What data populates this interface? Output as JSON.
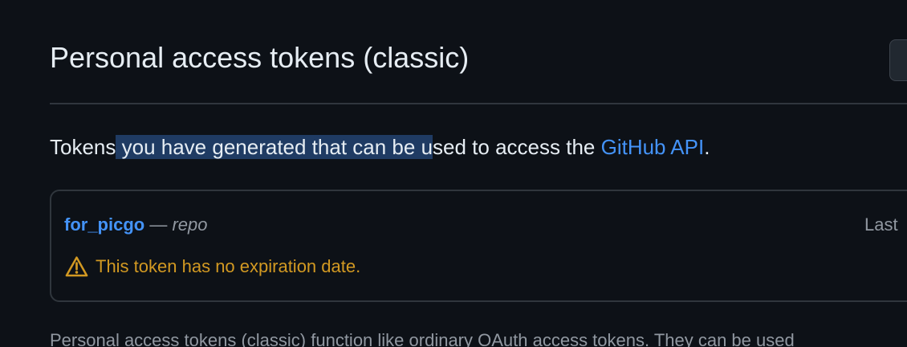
{
  "header": {
    "title": "Personal access tokens (classic)"
  },
  "intro": {
    "prefix": "Tokens",
    "highlighted": " you have generated that can be u",
    "middle": "sed to access the ",
    "link": "GitHub API",
    "suffix": "."
  },
  "tokens": [
    {
      "name": "for_picgo",
      "dash": " — ",
      "scope": "repo",
      "last_used": "Last",
      "warning": "This token has no expiration date."
    }
  ],
  "footer": {
    "text": "Personal access tokens (classic) function like ordinary OAuth access tokens. They can be used"
  },
  "colors": {
    "background": "#0d1117",
    "link": "#4493f8",
    "warning": "#d29922",
    "selection": "#1f3b63",
    "muted": "#9198a1"
  },
  "icons": {
    "warning": "alert-icon"
  }
}
